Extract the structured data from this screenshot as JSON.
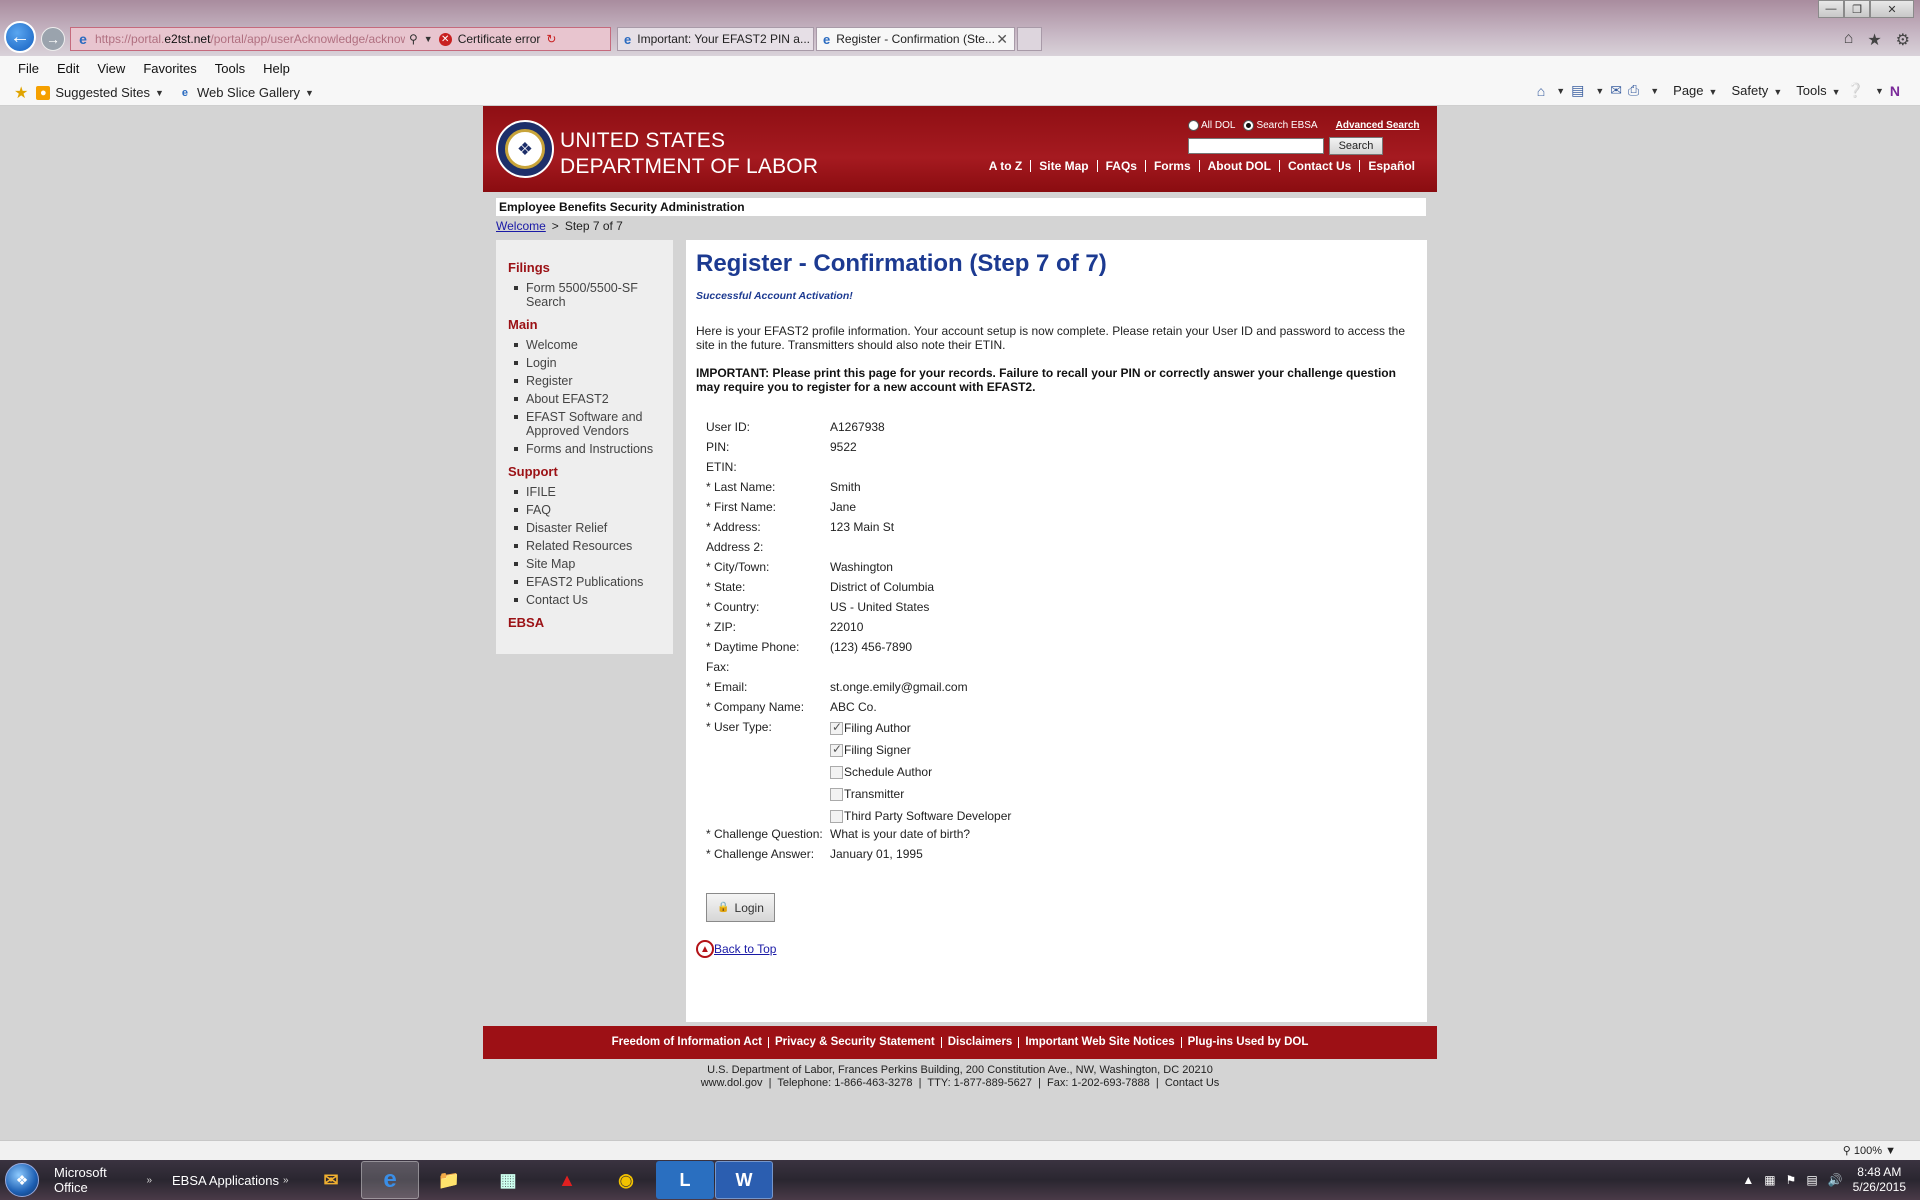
{
  "browser": {
    "address": {
      "prefix": "https://portal.",
      "domain": "e2tst.net",
      "suffix": "/portal/app/userAcknowledge/acknowledge"
    },
    "cert_error": "Certificate error",
    "tabs": [
      {
        "label": "Important: Your EFAST2 PIN a..."
      },
      {
        "label": "Register - Confirmation (Ste...",
        "active": true
      }
    ],
    "menu": [
      "File",
      "Edit",
      "View",
      "Favorites",
      "Tools",
      "Help"
    ],
    "favorites": {
      "suggested": "Suggested Sites",
      "webslice": "Web Slice Gallery"
    },
    "commands": {
      "page": "Page",
      "safety": "Safety",
      "tools": "Tools"
    },
    "zoom": "100%"
  },
  "header": {
    "agency_line1": "UNITED STATES",
    "agency_line2": "DEPARTMENT OF LABOR",
    "search": {
      "opt_all": "All DOL",
      "opt_ebsa": "Search EBSA",
      "advanced": "Advanced Search",
      "button": "Search",
      "selected": "Search EBSA"
    },
    "topnav": [
      "A to Z",
      "Site Map",
      "FAQs",
      "Forms",
      "About DOL",
      "Contact Us",
      "Español"
    ]
  },
  "subheader": "Employee Benefits Security Administration",
  "breadcrumb": {
    "home": "Welcome",
    "sep": ">",
    "current": "Step 7 of 7"
  },
  "sidebar": {
    "filings": {
      "heading": "Filings",
      "items": [
        "Form 5500/5500-SF Search"
      ]
    },
    "main": {
      "heading": "Main",
      "items": [
        "Welcome",
        "Login",
        "Register",
        "About EFAST2",
        "EFAST Software and Approved Vendors",
        "Forms and Instructions"
      ]
    },
    "support": {
      "heading": "Support",
      "items": [
        "IFILE",
        "FAQ",
        "Disaster Relief",
        "Related Resources",
        "Site Map",
        "EFAST2 Publications",
        "Contact Us"
      ]
    },
    "ebsa": "EBSA"
  },
  "main": {
    "title": "Register - Confirmation (Step 7 of 7)",
    "success": "Successful Account Activation!",
    "intro": "Here is your EFAST2 profile information. Your account setup is now complete. Please retain your User ID and password to access the site in the future. Transmitters should also note their ETIN.",
    "important": "IMPORTANT: Please print this page for your records. Failure to recall your PIN or correctly answer your challenge question may require you to register for a new account with EFAST2.",
    "profile": [
      {
        "label": "User ID:",
        "value": "A1267938"
      },
      {
        "label": "PIN:",
        "value": "9522"
      },
      {
        "label": "ETIN:",
        "value": ""
      },
      {
        "label": "* Last Name:",
        "value": "Smith"
      },
      {
        "label": "* First Name:",
        "value": "Jane"
      },
      {
        "label": "* Address:",
        "value": "123 Main St"
      },
      {
        "label": "Address 2:",
        "value": ""
      },
      {
        "label": "* City/Town:",
        "value": "Washington"
      },
      {
        "label": "* State:",
        "value": "District of Columbia"
      },
      {
        "label": "* Country:",
        "value": "US - United States"
      },
      {
        "label": "* ZIP:",
        "value": "22010"
      },
      {
        "label": "* Daytime Phone:",
        "value": "(123) 456-7890"
      },
      {
        "label": "Fax:",
        "value": ""
      },
      {
        "label": "* Email:",
        "value": "st.onge.emily@gmail.com"
      },
      {
        "label": "* Company Name:",
        "value": "ABC Co."
      }
    ],
    "user_type": {
      "label": "* User Type:",
      "options": [
        {
          "label": "Filing Author",
          "checked": true
        },
        {
          "label": "Filing Signer",
          "checked": true
        },
        {
          "label": "Schedule Author",
          "checked": false
        },
        {
          "label": "Transmitter",
          "checked": false
        },
        {
          "label": "Third Party Software Developer",
          "checked": false
        }
      ]
    },
    "challenge": [
      {
        "label": "* Challenge Question:",
        "value": "What is your date of birth?"
      },
      {
        "label": "* Challenge Answer:",
        "value": "January 01, 1995"
      }
    ],
    "login_button": "Login",
    "back_to_top": "Back to Top"
  },
  "footer": {
    "links": [
      "Freedom of Information Act",
      "Privacy & Security Statement",
      "Disclaimers",
      "Important Web Site Notices",
      "Plug-ins Used by DOL"
    ],
    "address_line1": "U.S. Department of Labor, Frances Perkins Building, 200 Constitution Ave., NW, Washington, DC 20210",
    "address_line2": "www.dol.gov  |  Telephone: 1-866-463-3278  |  TTY: 1-877-889-5627  |  Fax: 1-202-693-7888  |  Contact Us"
  },
  "taskbar": {
    "groups": [
      "Microsoft Office",
      "EBSA Applications"
    ],
    "apps": [
      "outlook-icon",
      "internet-explorer-icon",
      "file-explorer-icon",
      "calculator-icon",
      "acrobat-icon",
      "chrome-icon",
      "lync-icon",
      "word-icon"
    ],
    "time": "8:48 AM",
    "date": "5/26/2015"
  }
}
